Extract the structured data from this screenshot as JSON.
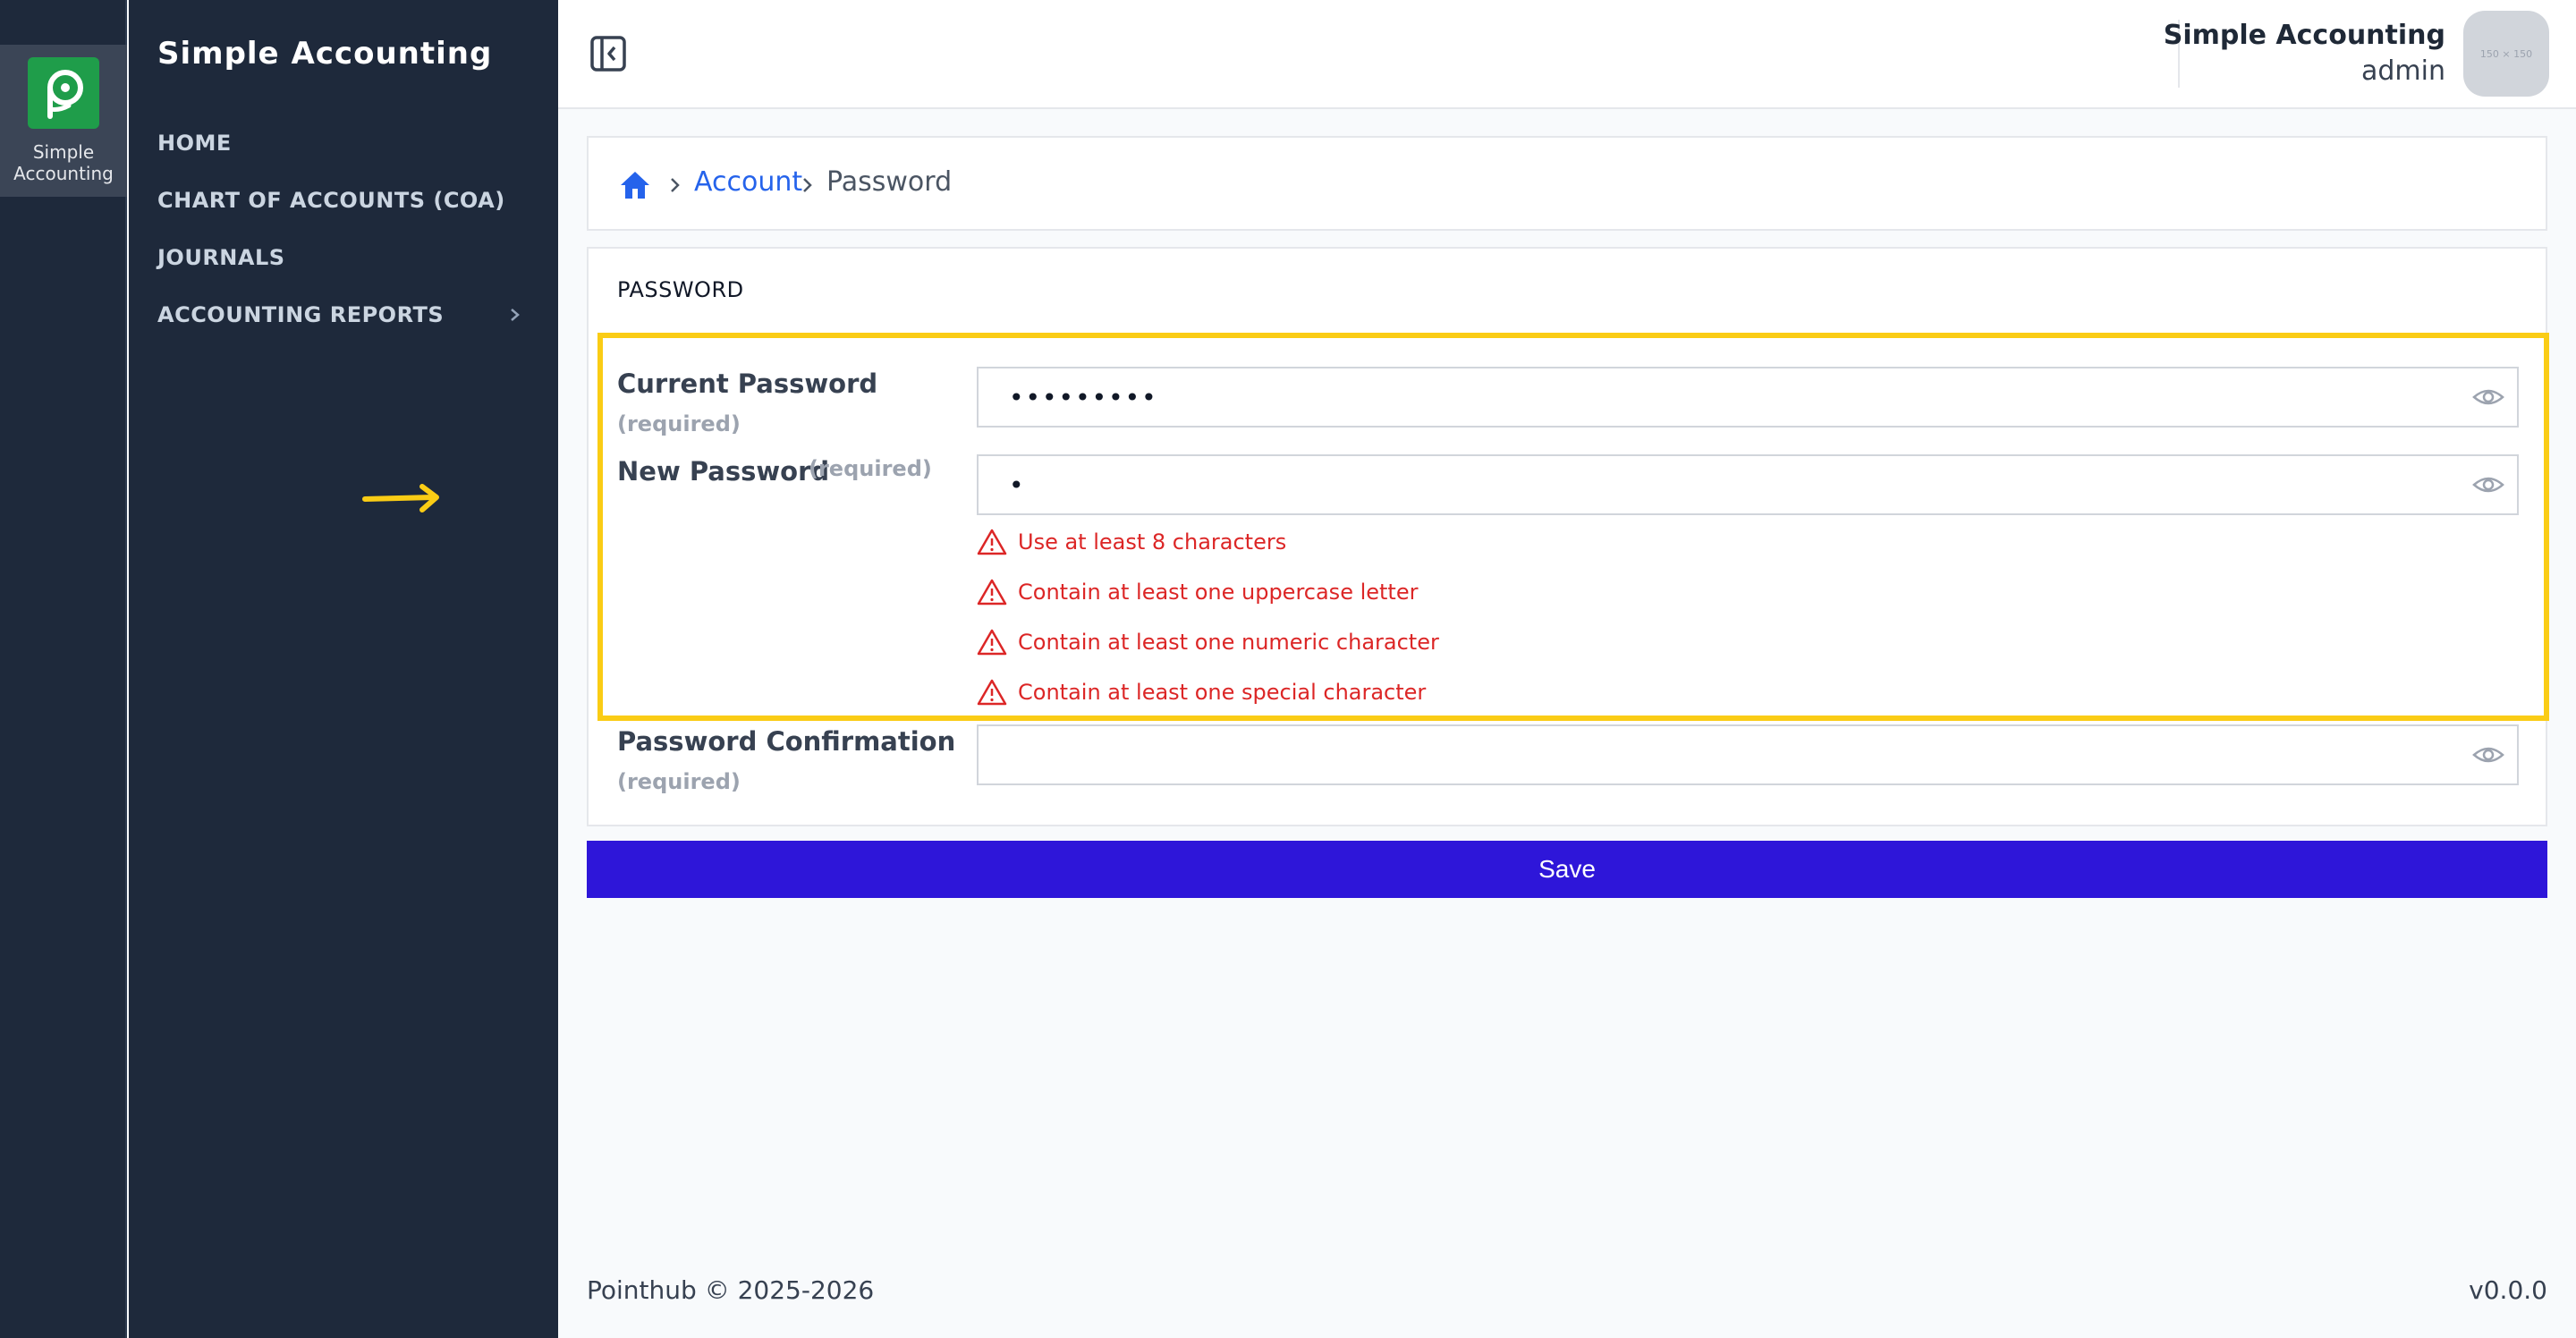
{
  "rail": {
    "app_label": "Simple Accounting",
    "logo_icon": "pointhub-logo"
  },
  "sidebar": {
    "brand": "Simple Accounting",
    "items": [
      {
        "label": "HOME"
      },
      {
        "label": "CHART OF ACCOUNTS (COA)"
      },
      {
        "label": "JOURNALS"
      },
      {
        "label": "ACCOUNTING REPORTS",
        "has_submenu": true
      }
    ]
  },
  "header": {
    "user_name": "Simple Accounting",
    "user_role": "admin",
    "avatar_placeholder": "150 × 150",
    "collapse_icon": "sidebar-collapse-icon"
  },
  "breadcrumb": {
    "home_icon": "home-icon",
    "items": [
      {
        "label": "Account"
      },
      {
        "label": "Password"
      }
    ]
  },
  "form": {
    "section_title": "PASSWORD",
    "required_text": "(required)",
    "current_password": {
      "label": "Current Password",
      "value": "•••••••••"
    },
    "new_password": {
      "label": "New Password",
      "value": "•",
      "errors": [
        "Use at least 8 characters",
        "Contain at least one uppercase letter",
        "Contain at least one numeric character",
        "Contain at least one special character"
      ]
    },
    "password_confirmation": {
      "label": "Password Confirmation",
      "value": ""
    },
    "save_label": "Save"
  },
  "footer": {
    "copyright": "Pointhub © 2025-2026",
    "version": "v0.0.0"
  },
  "colors": {
    "sidebar_bg": "#1e293b",
    "accent": "#2e16d9",
    "link": "#2563eb",
    "error": "#dc2626",
    "highlight": "#facc15"
  }
}
